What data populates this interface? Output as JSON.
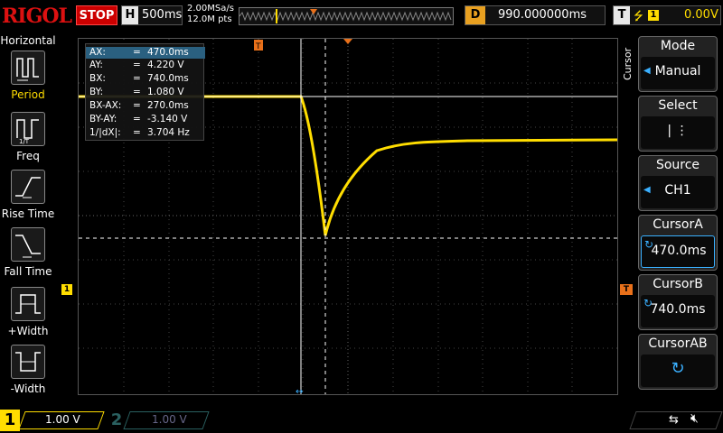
{
  "topbar": {
    "brand": "RIGOL",
    "run_state": "STOP",
    "timebase_key": "H",
    "timebase_value": "500ms",
    "sample_rate": "2.00MSa/s",
    "memory_depth": "12.0M pts",
    "delay_key": "D",
    "delay_value": "990.000000ms",
    "trigger_key": "T",
    "trigger_edge_icon": "rising-edge-icon",
    "trigger_source": "1",
    "trigger_level": "0.00V"
  },
  "left_menu": {
    "title": "Horizontal",
    "items": [
      {
        "label": "Period",
        "icon": "period-icon"
      },
      {
        "label": "Freq",
        "icon": "frequency-icon"
      },
      {
        "label": "Rise Time",
        "icon": "rise-time-icon"
      },
      {
        "label": "Fall Time",
        "icon": "fall-time-icon"
      },
      {
        "label": "+Width",
        "icon": "positive-width-icon"
      },
      {
        "label": "-Width",
        "icon": "negative-width-icon"
      }
    ]
  },
  "readout": {
    "rows": [
      {
        "k": "AX:",
        "v": "470.0ms"
      },
      {
        "k": "AY:",
        "v": "4.220 V"
      },
      {
        "k": "BX:",
        "v": "740.0ms"
      },
      {
        "k": "BY:",
        "v": "1.080 V"
      },
      {
        "k": "BX-AX:",
        "v": "270.0ms"
      },
      {
        "k": "BY-AY:",
        "v": "-3.140 V"
      },
      {
        "k": "1/|dX|:",
        "v": "3.704 Hz"
      }
    ],
    "eq": "="
  },
  "right_menu": {
    "side_tab": "Cursor",
    "items": [
      {
        "title": "Mode",
        "value": "Manual"
      },
      {
        "title": "Select",
        "value": "| ⋮"
      },
      {
        "title": "Source",
        "value": "CH1"
      },
      {
        "title": "CursorA",
        "value": "470.0ms"
      },
      {
        "title": "CursorB",
        "value": "740.0ms"
      },
      {
        "title": "CursorAB",
        "value": ""
      }
    ]
  },
  "bottombar": {
    "ch1_label": "1",
    "ch1_scale": "1.00 V",
    "ch2_label": "2",
    "ch2_scale": "1.00 V"
  },
  "colors": {
    "ch1": "#ffdd00",
    "cursor": "#ffffff",
    "accent": "#3ab0ff",
    "stop": "#cc0000"
  }
}
